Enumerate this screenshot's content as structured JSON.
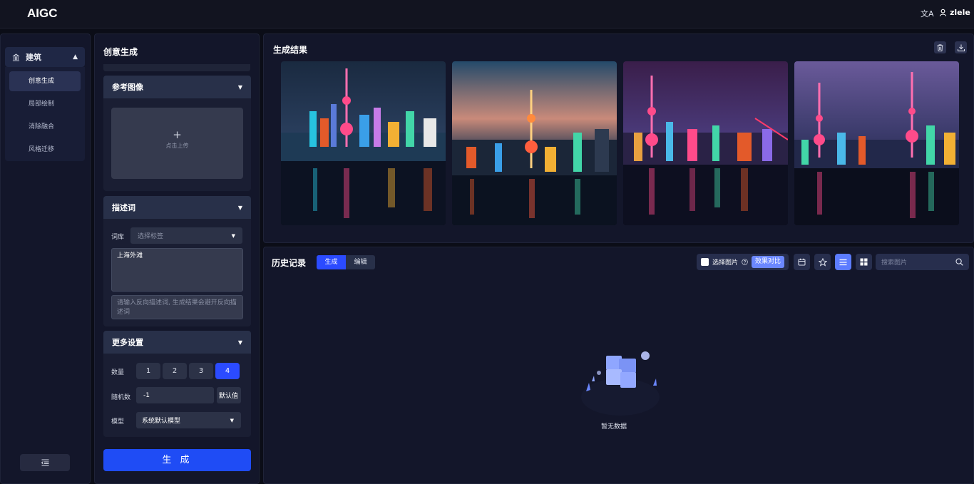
{
  "app": {
    "logo": "AIGC",
    "translate_icon": "文A",
    "username": "zlele"
  },
  "sidebar": {
    "category": "建筑",
    "items": [
      {
        "label": "创意生成",
        "active": true
      },
      {
        "label": "局部绘制",
        "active": false
      },
      {
        "label": "消除融合",
        "active": false
      },
      {
        "label": "风格迁移",
        "active": false
      }
    ]
  },
  "generator": {
    "title": "创意生成",
    "reference": {
      "header": "参考图像",
      "upload_plus": "+",
      "upload_label": "点击上传"
    },
    "prompt": {
      "header": "描述词",
      "lexicon_label": "词库",
      "lexicon_placeholder": "选择标签",
      "prompt_value": "上海外滩",
      "negative_placeholder": "请输入反向描述词, 生成结果会避开反向描述词"
    },
    "more": {
      "header": "更多设置",
      "count_label": "数量",
      "counts": [
        "1",
        "2",
        "3",
        "4"
      ],
      "count_selected": "4",
      "seed_label": "随机数",
      "seed_value": "-1",
      "seed_default": "默认值",
      "model_label": "模型",
      "model_value": "系统默认模型"
    },
    "generate_button": "生 成"
  },
  "results": {
    "title": "生成结果",
    "image_count": 4
  },
  "history": {
    "title": "历史记录",
    "tabs": [
      "生成",
      "编辑"
    ],
    "active_tab": "生成",
    "select_images": "选择图片",
    "compare": "效果对比",
    "search_placeholder": "搜索图片",
    "empty_text": "暂无数据"
  },
  "colors": {
    "accent": "#2b4bff",
    "panel": "#13162a",
    "background": "#0b0d17"
  }
}
